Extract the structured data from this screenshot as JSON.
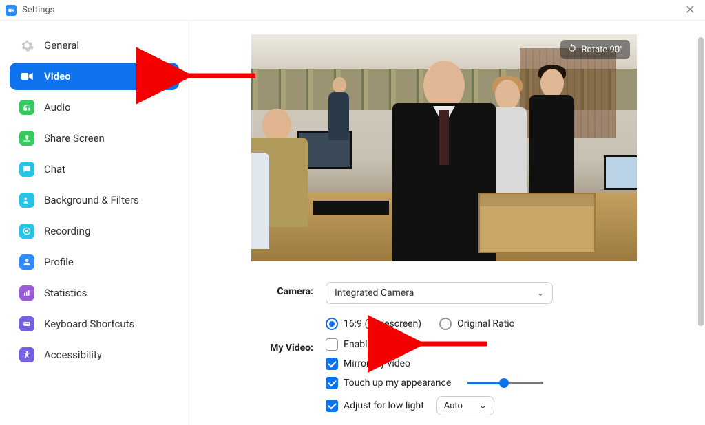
{
  "window": {
    "title": "Settings"
  },
  "sidebar": {
    "items": [
      {
        "id": "general",
        "label": "General"
      },
      {
        "id": "video",
        "label": "Video",
        "active": true
      },
      {
        "id": "audio",
        "label": "Audio"
      },
      {
        "id": "share",
        "label": "Share Screen"
      },
      {
        "id": "chat",
        "label": "Chat"
      },
      {
        "id": "bg",
        "label": "Background & Filters"
      },
      {
        "id": "recording",
        "label": "Recording"
      },
      {
        "id": "profile",
        "label": "Profile"
      },
      {
        "id": "stats",
        "label": "Statistics"
      },
      {
        "id": "shortcuts",
        "label": "Keyboard Shortcuts"
      },
      {
        "id": "accessibility",
        "label": "Accessibility"
      }
    ]
  },
  "preview": {
    "rotate_label": "Rotate 90°"
  },
  "camera": {
    "label": "Camera:",
    "selected": "Integrated Camera",
    "ratio_wide": "16:9 (Widescreen)",
    "ratio_orig": "Original Ratio",
    "ratio_value": "wide"
  },
  "myvideo": {
    "label": "My Video:",
    "enable_hd": {
      "label": "Enable HD",
      "checked": false
    },
    "mirror": {
      "label": "Mirror my video",
      "checked": true
    },
    "touchup": {
      "label": "Touch up my appearance",
      "checked": true,
      "slider": 0.47
    },
    "lowlight": {
      "label": "Adjust for low light",
      "checked": true,
      "mode": "Auto"
    }
  }
}
